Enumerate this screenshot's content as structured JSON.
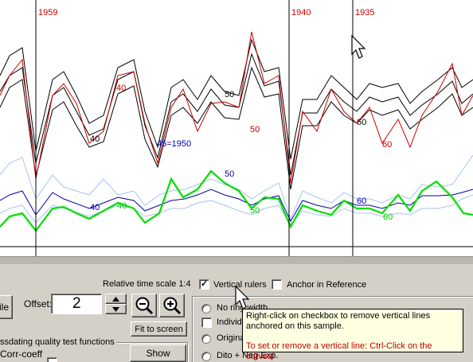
{
  "rulers": [
    {
      "year": "1959"
    },
    {
      "year": "1940"
    },
    {
      "year": "1935"
    }
  ],
  "plot_labels": {
    "black_40": "40",
    "red_40": "40",
    "black_50": "50",
    "red_50": "50",
    "blue_45": "45=1950",
    "black_60": "60",
    "red_60": "60",
    "blue_40": "40",
    "green_40": "40",
    "blue_50": "50",
    "green_50": "50",
    "blue_60": "60",
    "green_60": "60"
  },
  "colors": {
    "black_curves": "#000000",
    "red_curve": "#cc0000",
    "blue_curve": "#0000aa",
    "light_blue_curves": "#a8c4ee",
    "green_curve": "#00dd00",
    "ruler_label": "#cc0000",
    "tooltip_bg": "#ffffe1"
  },
  "controls": {
    "file_button": "ile",
    "offset_label": "Offset:",
    "offset_value": "2",
    "relative_time_scale": "Relative time scale 1:4",
    "fit_to_screen": "Fit to screen",
    "vertical_rulers": "Vertical rulers",
    "vertical_rulers_checked": "✓",
    "anchor_in_reference": "Anchor in Reference",
    "crossdating_group": "ssdating quality test functions",
    "corr_coeff": "Corr-coeff",
    "show_button": "Show",
    "no_ring_width": "No ring width",
    "individual": "Individual",
    "original": "Original",
    "dito_neg_exp": "Dito + Neg Exp."
  },
  "tooltip": {
    "line1": "Right-click on checkbox to remove vertical lines",
    "line2": "anchored on this sample.",
    "line3": "To set or remove a vertical line: Ctrl-Click on the curves!"
  },
  "icons": {
    "spin_up": "triangle-up-icon",
    "spin_down": "triangle-down-icon",
    "zoom_out": "zoom-out-icon",
    "zoom_in": "zoom-in-icon",
    "cursor": "arrow-cursor-icon"
  }
}
